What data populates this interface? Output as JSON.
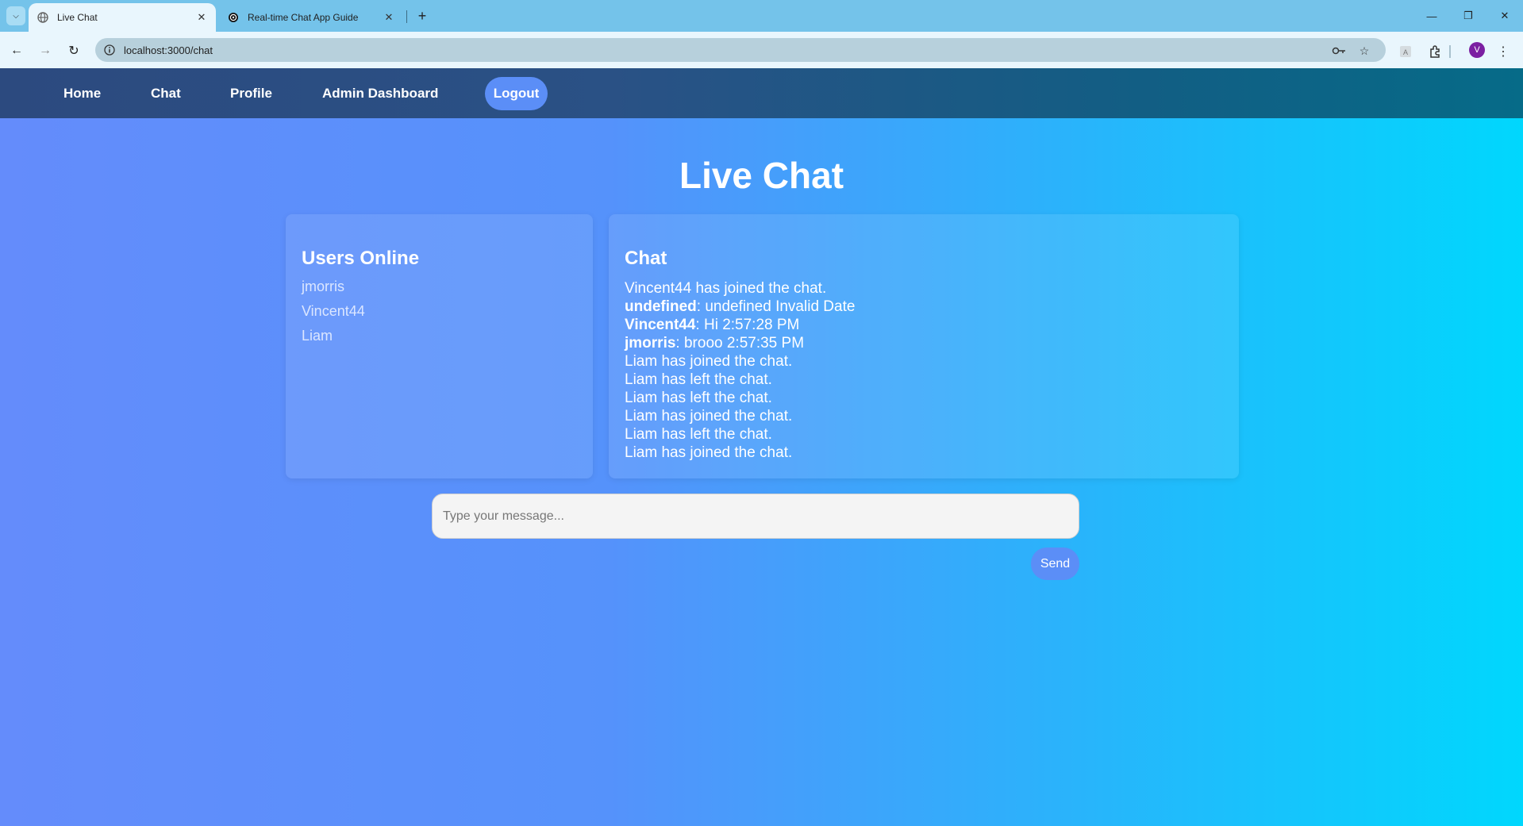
{
  "browser": {
    "tabs": [
      {
        "title": "Live Chat",
        "active": true,
        "favicon": "globe-icon"
      },
      {
        "title": "Real-time Chat App Guide",
        "active": false,
        "favicon": "openai-icon"
      }
    ],
    "url": "localhost:3000/chat",
    "profile_initial": "V"
  },
  "nav": {
    "home": "Home",
    "chat": "Chat",
    "profile": "Profile",
    "admin": "Admin Dashboard",
    "logout": "Logout"
  },
  "page": {
    "title": "Live Chat"
  },
  "users_panel": {
    "heading": "Users Online",
    "users": [
      "jmorris",
      "Vincent44",
      "Liam"
    ]
  },
  "chat_panel": {
    "heading": "Chat",
    "messages": [
      {
        "sender": "",
        "text": "Vincent44 has joined the chat."
      },
      {
        "sender": "undefined",
        "text": ": undefined Invalid Date"
      },
      {
        "sender": "Vincent44",
        "text": ": Hi 2:57:28 PM"
      },
      {
        "sender": "jmorris",
        "text": ": brooo 2:57:35 PM"
      },
      {
        "sender": "",
        "text": "Liam has joined the chat."
      },
      {
        "sender": "",
        "text": "Liam has left the chat."
      },
      {
        "sender": "",
        "text": "Liam has left the chat."
      },
      {
        "sender": "",
        "text": "Liam has joined the chat."
      },
      {
        "sender": "",
        "text": "Liam has left the chat."
      },
      {
        "sender": "",
        "text": "Liam has joined the chat."
      }
    ]
  },
  "composer": {
    "placeholder": "Type your message...",
    "value": "",
    "send_label": "Send"
  },
  "colors": {
    "nav_bg_start": "#2c4a7f",
    "nav_bg_end": "#066b88",
    "page_gradient_start": "#648cfb",
    "page_gradient_end": "#00d7fd",
    "button_accent": "#5b8ef7"
  }
}
